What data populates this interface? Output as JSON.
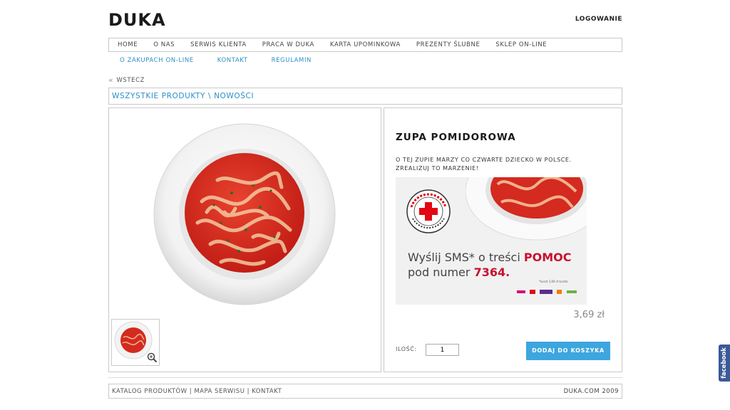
{
  "header": {
    "logo": "DUKA",
    "login": "LOGOWANIE"
  },
  "main_nav": [
    "HOME",
    "O NAS",
    "SERWIS KLIENTA",
    "PRACA W DUKA",
    "KARTA UPOMINKOWA",
    "PREZENTY ŚLUBNE",
    "SKLEP ON-LINE"
  ],
  "sub_nav": [
    "O ZAKUPACH ON-LINE",
    "KONTAKT",
    "REGULAMIN"
  ],
  "back": "WSTECZ",
  "breadcrumb": {
    "all": "WSZYSTKIE PRODUKTY",
    "sep": " \\ ",
    "current": "NOWOŚCI"
  },
  "product": {
    "title": "ZUPA POMIDOROWA",
    "description": "O TEJ ZUPIE MARZY CO CZWARTE DZIECKO W POLSCE. ZREALIZUJ TO MARZENIE!",
    "price": "3,69 zł",
    "qty_label": "ILOŚĆ:",
    "qty_value": "1",
    "add_to_cart": "DODAJ DO KOSZYKA"
  },
  "banner": {
    "seal_text": "POLSKI CZERWONY KRZYŻ",
    "line1_a": "Wyślij SMS* o treści ",
    "line1_b": "POMOC",
    "line2_a": "pod numer ",
    "line2_b": "7364.",
    "note": "*koszt 3,69 zł brutto"
  },
  "footer": {
    "links": [
      "KATALOG PRODUKTÓW",
      "MAPA SERWISU",
      "KONTAKT"
    ],
    "sep": " | ",
    "copyright": "DUKA.COM 2009"
  },
  "facebook": "facebook",
  "colors": {
    "accent": "#3ea6de",
    "link": "#2d8fc7",
    "soup": "#d9291f",
    "red_cross": "#e30613",
    "facebook": "#3b5998"
  }
}
